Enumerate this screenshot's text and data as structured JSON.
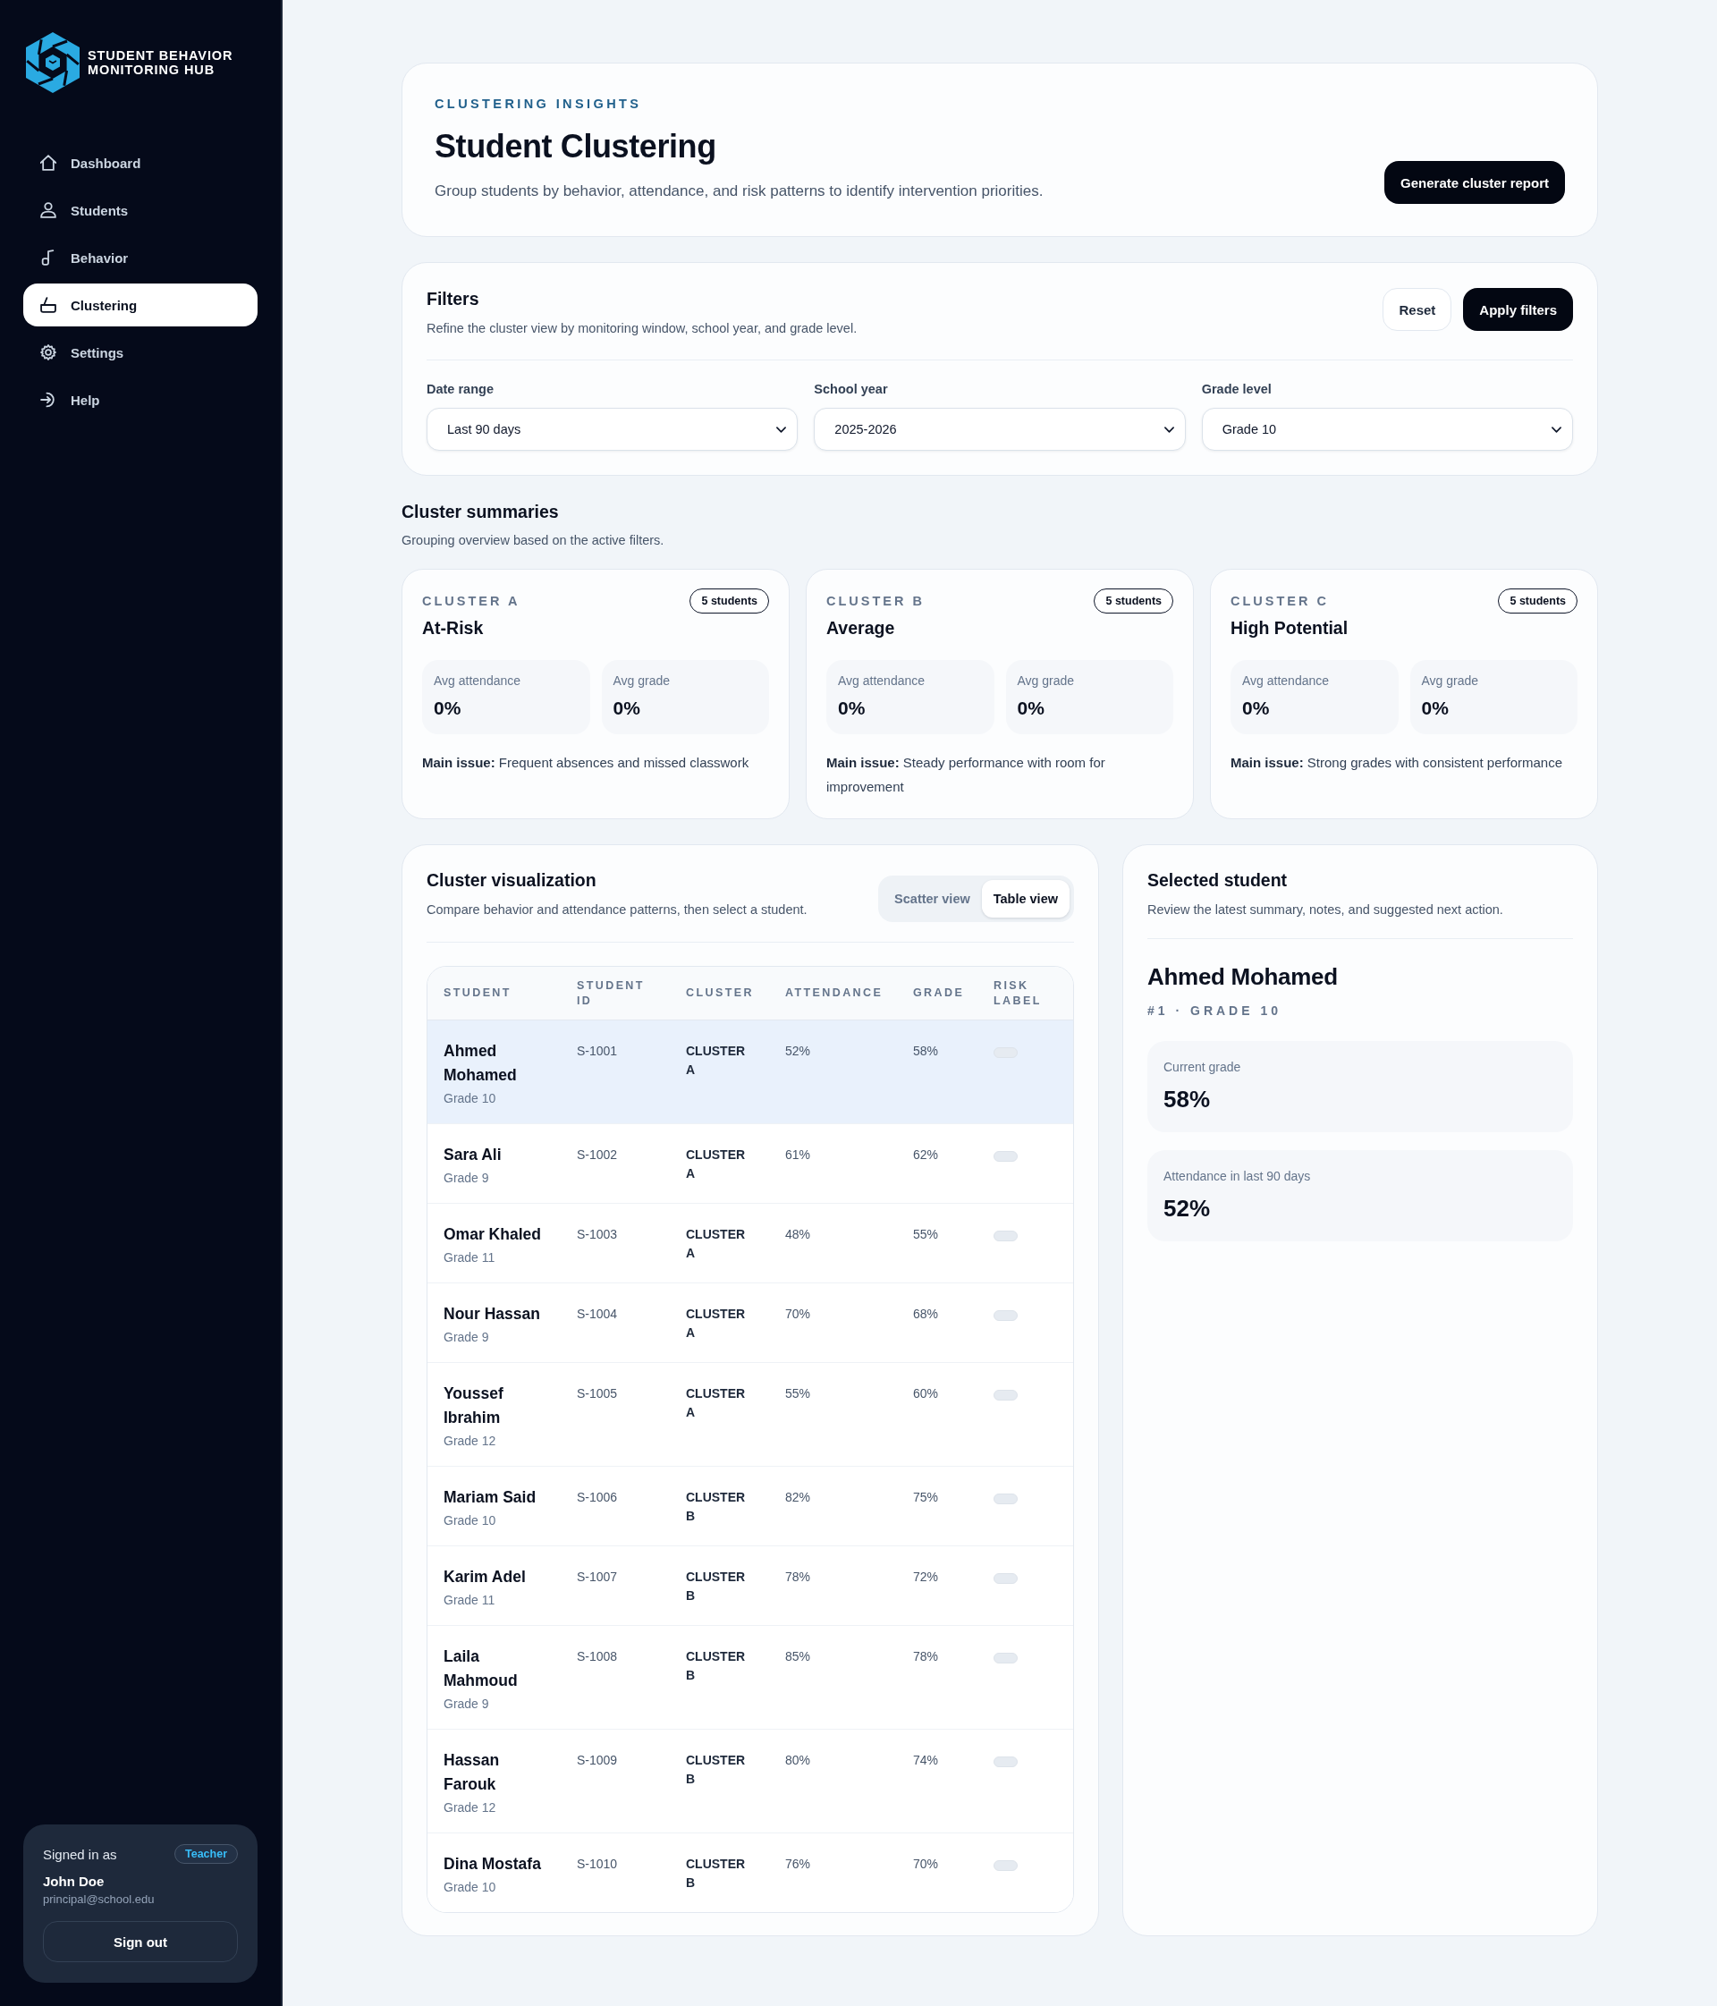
{
  "sidebar": {
    "brand": [
      "STUDENT BEHAVIOR",
      "MONITORING HUB"
    ],
    "nav": [
      {
        "label": "Dashboard",
        "kind": "home",
        "selected": false
      },
      {
        "label": "Students",
        "kind": "people",
        "selected": false
      },
      {
        "label": "Behavior",
        "kind": "behavior",
        "selected": false
      },
      {
        "label": "Clustering",
        "kind": "clusters",
        "selected": true
      },
      {
        "label": "Settings",
        "kind": "settings",
        "selected": false
      },
      {
        "label": "Help",
        "kind": "help",
        "selected": false
      }
    ],
    "account": {
      "caption": "Signed in as",
      "role": "Teacher",
      "name": "John Doe",
      "email": "principal@school.edu",
      "action": "Sign out"
    }
  },
  "header": {
    "eyebrow": "CLUSTERING INSIGHTS",
    "title": "Student Clustering",
    "subtitle": "Group students by behavior, attendance, and risk patterns to identify intervention priorities.",
    "action": "Generate cluster report"
  },
  "filters": {
    "title": "Filters",
    "subtitle": "Refine the cluster view by monitoring window, school year, and grade level.",
    "actions": {
      "reset": "Reset",
      "apply": "Apply filters"
    },
    "fields": [
      {
        "label": "Date range",
        "value": "Last 90 days"
      },
      {
        "label": "School year",
        "value": "2025-2026"
      },
      {
        "label": "Grade level",
        "value": "Grade 10"
      }
    ]
  },
  "cluster_summaries": {
    "title": "Cluster summaries",
    "subtitle": "Grouping overview based on the active filters.",
    "clusters": [
      {
        "eyebrow": "CLUSTER A",
        "name": "At-Risk",
        "badge": "5 students",
        "stats": [
          {
            "label": "Avg attendance",
            "value": "0%"
          },
          {
            "label": "Avg grade",
            "value": "0%"
          }
        ],
        "main_issue": "**Main issue:** Frequent absences and missed classwork"
      },
      {
        "eyebrow": "CLUSTER B",
        "name": "Average",
        "badge": "5 students",
        "stats": [
          {
            "label": "Avg attendance",
            "value": "0%"
          },
          {
            "label": "Avg grade",
            "value": "0%"
          }
        ],
        "main_issue": "**Main issue:** Steady performance with room for improvement"
      },
      {
        "eyebrow": "CLUSTER C",
        "name": "High Potential",
        "badge": "5 students",
        "stats": [
          {
            "label": "Avg attendance",
            "value": "0%"
          },
          {
            "label": "Avg grade",
            "value": "0%"
          }
        ],
        "main_issue": "**Main issue:** Strong grades with consistent performance"
      }
    ]
  },
  "visualization": {
    "title": "Cluster visualization",
    "subtitle": "Compare behavior and attendance patterns, then select a student.",
    "view_toggle": [
      {
        "label": "Scatter view",
        "selected": false
      },
      {
        "label": "Table view",
        "selected": true
      }
    ],
    "table": {
      "columns": [
        "STUDENT",
        "STUDENT ID",
        "CLUSTER",
        "ATTENDANCE",
        "GRADE",
        "RISK LABEL"
      ],
      "rows": [
        {
          "name": "Ahmed Mohamed",
          "grade_level": "Grade 10",
          "student_id": "S-1001",
          "cluster": "CLUSTER A",
          "attendance": "52%",
          "grade": "58%",
          "selected": true
        },
        {
          "name": "Sara Ali",
          "grade_level": "Grade 9",
          "student_id": "S-1002",
          "cluster": "CLUSTER A",
          "attendance": "61%",
          "grade": "62%",
          "selected": false
        },
        {
          "name": "Omar Khaled",
          "grade_level": "Grade 11",
          "student_id": "S-1003",
          "cluster": "CLUSTER A",
          "attendance": "48%",
          "grade": "55%",
          "selected": false
        },
        {
          "name": "Nour Hassan",
          "grade_level": "Grade 9",
          "student_id": "S-1004",
          "cluster": "CLUSTER A",
          "attendance": "70%",
          "grade": "68%",
          "selected": false
        },
        {
          "name": "Youssef Ibrahim",
          "grade_level": "Grade 12",
          "student_id": "S-1005",
          "cluster": "CLUSTER A",
          "attendance": "55%",
          "grade": "60%",
          "selected": false
        },
        {
          "name": "Mariam Said",
          "grade_level": "Grade 10",
          "student_id": "S-1006",
          "cluster": "CLUSTER B",
          "attendance": "82%",
          "grade": "75%",
          "selected": false
        },
        {
          "name": "Karim Adel",
          "grade_level": "Grade 11",
          "student_id": "S-1007",
          "cluster": "CLUSTER B",
          "attendance": "78%",
          "grade": "72%",
          "selected": false
        },
        {
          "name": "Laila Mahmoud",
          "grade_level": "Grade 9",
          "student_id": "S-1008",
          "cluster": "CLUSTER B",
          "attendance": "85%",
          "grade": "78%",
          "selected": false
        },
        {
          "name": "Hassan Farouk",
          "grade_level": "Grade 12",
          "student_id": "S-1009",
          "cluster": "CLUSTER B",
          "attendance": "80%",
          "grade": "74%",
          "selected": false
        },
        {
          "name": "Dina Mostafa",
          "grade_level": "Grade 10",
          "student_id": "S-1010",
          "cluster": "CLUSTER B",
          "attendance": "76%",
          "grade": "70%",
          "selected": false
        }
      ]
    }
  },
  "selected_student": {
    "title": "Selected student",
    "subtitle": "Review the latest summary, notes, and suggested next action.",
    "name": "Ahmed Mohamed",
    "meta": "#1 · GRADE 10",
    "stats": [
      {
        "label": "Current grade",
        "value": "58%"
      },
      {
        "label": "Attendance in last 90 days",
        "value": "52%"
      }
    ]
  }
}
